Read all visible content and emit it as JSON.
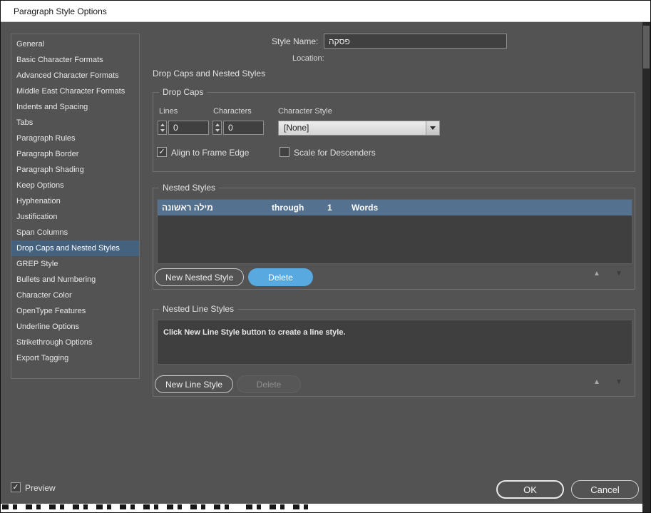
{
  "window": {
    "title": "Paragraph Style Options"
  },
  "colors": {
    "dialog_bg": "#535353",
    "titlebar_bg": "#ffffff",
    "selection": "#44617e",
    "row_selection": "#54718f",
    "accent_blue": "#57a9df",
    "panel_bg": "#3f3f3f"
  },
  "icons": {
    "checkmark": "✓",
    "triangle_up": "▲",
    "triangle_down": "▼"
  },
  "sidebar": {
    "items": [
      {
        "label": "General",
        "selected": false
      },
      {
        "label": "Basic Character Formats",
        "selected": false
      },
      {
        "label": "Advanced Character Formats",
        "selected": false
      },
      {
        "label": "Middle East Character Formats",
        "selected": false
      },
      {
        "label": "Indents and Spacing",
        "selected": false
      },
      {
        "label": "Tabs",
        "selected": false
      },
      {
        "label": "Paragraph Rules",
        "selected": false
      },
      {
        "label": "Paragraph Border",
        "selected": false
      },
      {
        "label": "Paragraph Shading",
        "selected": false
      },
      {
        "label": "Keep Options",
        "selected": false
      },
      {
        "label": "Hyphenation",
        "selected": false
      },
      {
        "label": "Justification",
        "selected": false
      },
      {
        "label": "Span Columns",
        "selected": false
      },
      {
        "label": "Drop Caps and Nested Styles",
        "selected": true
      },
      {
        "label": "GREP Style",
        "selected": false
      },
      {
        "label": "Bullets and Numbering",
        "selected": false
      },
      {
        "label": "Character Color",
        "selected": false
      },
      {
        "label": "OpenType Features",
        "selected": false
      },
      {
        "label": "Underline Options",
        "selected": false
      },
      {
        "label": "Strikethrough Options",
        "selected": false
      },
      {
        "label": "Export Tagging",
        "selected": false
      }
    ]
  },
  "header": {
    "style_name_label": "Style Name:",
    "style_name_value": "פסקה",
    "location_label": "Location:",
    "section_title": "Drop Caps and Nested Styles"
  },
  "drop_caps": {
    "legend": "Drop Caps",
    "lines_label": "Lines",
    "lines_value": "0",
    "characters_label": "Characters",
    "characters_value": "0",
    "character_style_label": "Character Style",
    "character_style_value": "[None]",
    "align_label": "Align to Frame Edge",
    "align_checked": true,
    "scale_label": "Scale for Descenders",
    "scale_checked": false
  },
  "nested_styles": {
    "legend": "Nested Styles",
    "row": {
      "style": "מילה ראשונה",
      "mode": "through",
      "count": "1",
      "unit": "Words"
    },
    "new_button": "New Nested Style",
    "delete_button": "Delete"
  },
  "nested_line_styles": {
    "legend": "Nested Line Styles",
    "hint": "Click New Line Style button to create a line style.",
    "new_button": "New Line Style",
    "delete_button": "Delete"
  },
  "footer": {
    "preview_label": "Preview",
    "preview_checked": true,
    "ok_label": "OK",
    "cancel_label": "Cancel"
  }
}
